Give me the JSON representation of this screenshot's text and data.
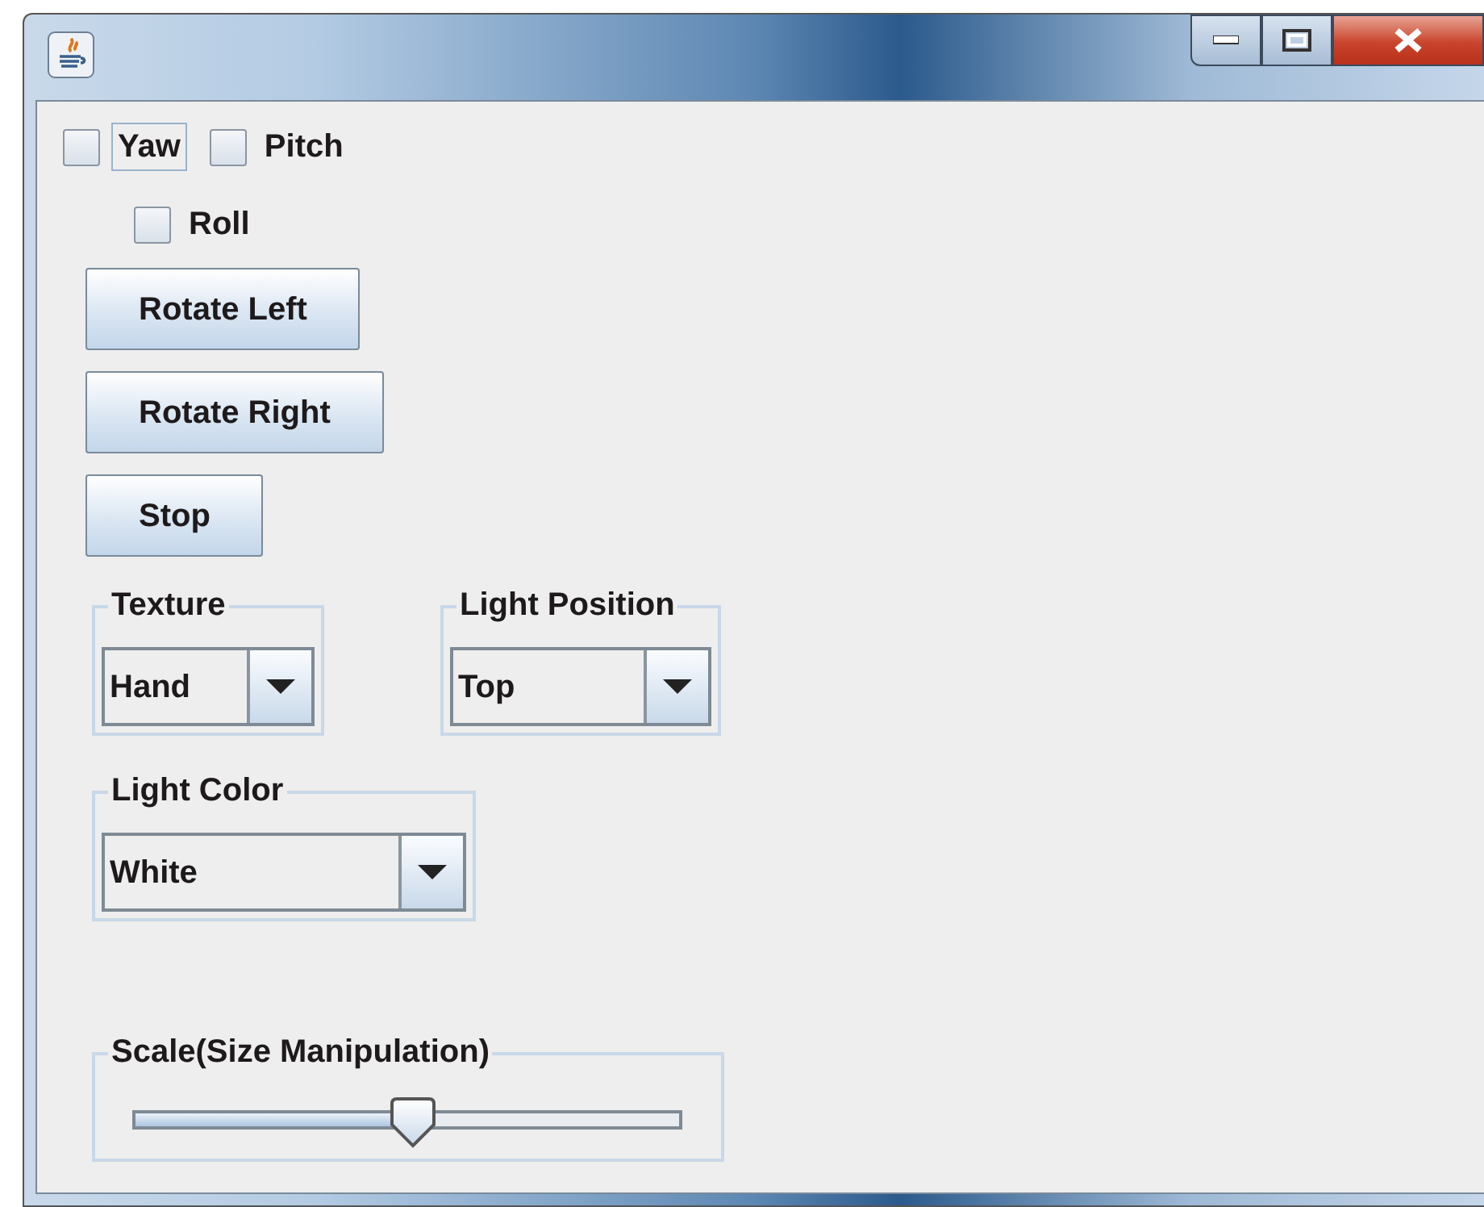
{
  "checkboxes": [
    {
      "label": "Yaw",
      "checked": false,
      "focused": true
    },
    {
      "label": "Pitch",
      "checked": false,
      "focused": false
    },
    {
      "label": "Roll",
      "checked": false,
      "focused": false
    }
  ],
  "buttons": [
    "Rotate Left",
    "Rotate Right",
    "Stop"
  ],
  "groups": [
    {
      "title": "Texture",
      "value": "Hand"
    },
    {
      "title": "Light Position",
      "value": "Top"
    },
    {
      "title": "Light Color",
      "value": "White"
    }
  ],
  "slider": {
    "title": "Scale(Size Manipulation)",
    "level": 0.51
  }
}
